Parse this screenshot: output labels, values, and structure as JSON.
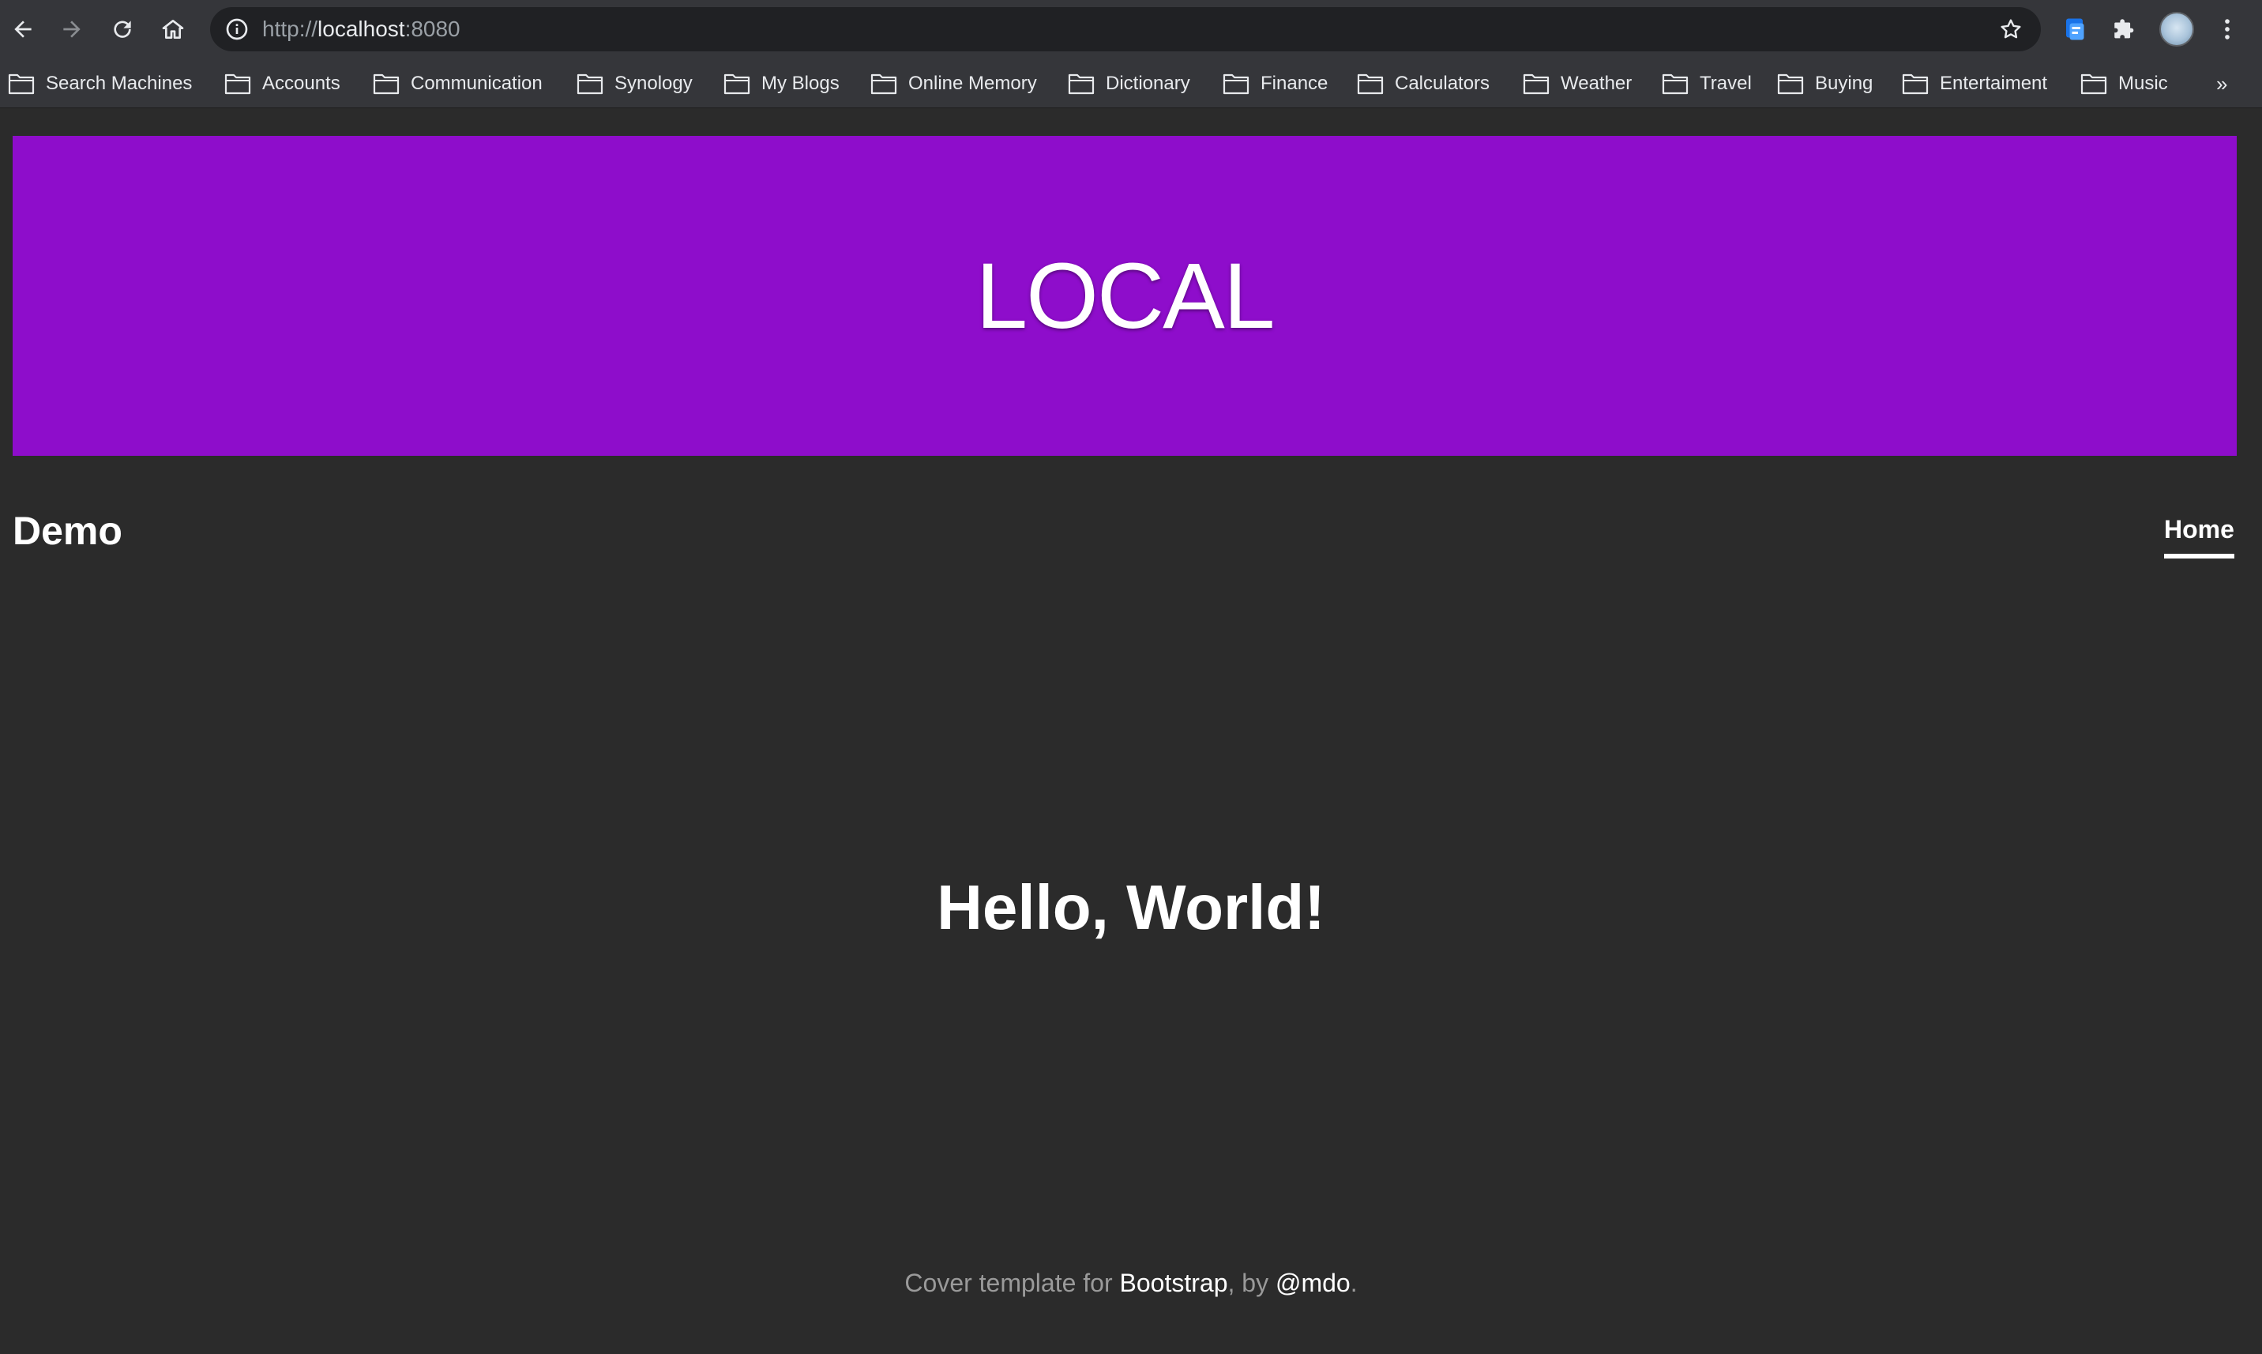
{
  "browser": {
    "url_scheme": "http://",
    "url_host": "localhost",
    "url_port": ":8080",
    "bookmarks": [
      {
        "label": "Search Machines"
      },
      {
        "label": "Accounts"
      },
      {
        "label": "Communication"
      },
      {
        "label": "Synology"
      },
      {
        "label": "My Blogs"
      },
      {
        "label": "Online Memory"
      },
      {
        "label": "Dictionary"
      },
      {
        "label": "Finance"
      },
      {
        "label": "Calculators"
      },
      {
        "label": "Weather"
      },
      {
        "label": "Travel"
      },
      {
        "label": "Buying"
      },
      {
        "label": "Entertaiment"
      },
      {
        "label": "Music"
      }
    ],
    "more_label": "»"
  },
  "page": {
    "banner_text": "LOCAL",
    "banner_color": "#8e0dcb",
    "brand": "Demo",
    "nav_home": "Home",
    "heading": "Hello, World!",
    "footer": {
      "prefix": "Cover template for ",
      "link1": "Bootstrap",
      "middle": ", by ",
      "link2": "@mdo",
      "suffix": "."
    }
  }
}
